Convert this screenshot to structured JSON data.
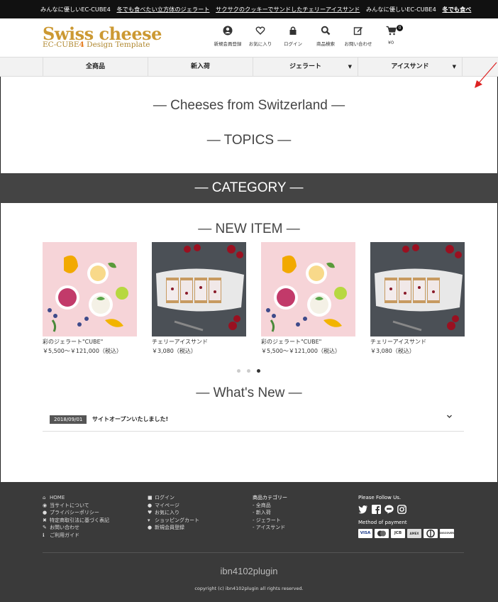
{
  "ticker": {
    "items": [
      {
        "text": "みんなに優しいEC-CUBE4",
        "style": "plain"
      },
      {
        "text": "冬でも食べたい立方体のジェラート",
        "style": "underline"
      },
      {
        "text": "サクサクのクッキーでサンドしたチェリーアイスサンド",
        "style": "underline"
      },
      {
        "text": "みんなに優しいEC-CUBE4",
        "style": "plain"
      },
      {
        "text": "冬でも食べ",
        "style": "bold-underline"
      }
    ]
  },
  "header": {
    "logo_title": "Swiss cheese",
    "logo_sub_prefix": "EC-CUBE",
    "logo_sub_num": "4",
    "logo_sub_suffix": " Design Template",
    "icons": [
      {
        "icon": "user-circle-icon",
        "label": "新規会員登録"
      },
      {
        "icon": "heart-icon",
        "label": "お気に入り"
      },
      {
        "icon": "lock-icon",
        "label": "ログイン"
      },
      {
        "icon": "search-icon",
        "label": "商品検索"
      },
      {
        "icon": "edit-icon",
        "label": "お問い合わせ"
      },
      {
        "icon": "cart-icon",
        "label": "¥0",
        "badge": "0"
      }
    ]
  },
  "nav": {
    "items": [
      {
        "label": "全商品",
        "dropdown": false
      },
      {
        "label": "新入荷",
        "dropdown": false
      },
      {
        "label": "ジェラート",
        "dropdown": true
      },
      {
        "label": "アイスサンド",
        "dropdown": true
      }
    ]
  },
  "sections": {
    "cheeses": "— Cheeses from Switzerland —",
    "topics": "— TOPICS —",
    "category": "— CATEGORY —",
    "new_item": "— NEW ITEM —",
    "whats_new": "— What's New —"
  },
  "products": [
    {
      "name": "彩のジェラート\"CUBE\"",
      "price": "￥5,500～￥121,000（税込）",
      "image": "gelato"
    },
    {
      "name": "チェリーアイスサンド",
      "price": "￥3,080（税込）",
      "image": "cherry"
    },
    {
      "name": "彩のジェラート\"CUBE\"",
      "price": "￥5,500～￥121,000（税込）",
      "image": "gelato"
    },
    {
      "name": "チェリーアイスサンド",
      "price": "￥3,080（税込）",
      "image": "cherry"
    }
  ],
  "carousel": {
    "count": 3,
    "active": 3
  },
  "news": [
    {
      "date": "2018/09/01",
      "title": "サイトオープンいたしました!"
    }
  ],
  "footer": {
    "col1": [
      {
        "icon": "home-icon",
        "label": "HOME"
      },
      {
        "icon": "info-icon",
        "label": "当サイトについて"
      },
      {
        "icon": "shield-icon",
        "label": "プライバシーポリシー"
      },
      {
        "icon": "tools-icon",
        "label": "特定商取引法に基づく表記"
      },
      {
        "icon": "mail-edit-icon",
        "label": "お問い合わせ"
      },
      {
        "icon": "info-i-icon",
        "label": "ご利用ガイド"
      }
    ],
    "col2": [
      {
        "icon": "lock-icon",
        "label": "ログイン"
      },
      {
        "icon": "user-cog-icon",
        "label": "マイページ"
      },
      {
        "icon": "heart-icon",
        "label": "お気に入り"
      },
      {
        "icon": "cart-icon",
        "label": "ショッピングカート"
      },
      {
        "icon": "user-icon",
        "label": "新規会員登録"
      }
    ],
    "col3_title": "商品カテゴリー",
    "col3": [
      "- 全商品",
      "- 新入荷",
      "- ジェラート",
      "- アイスサンド"
    ],
    "follow_title": "Please Follow Us.",
    "social": [
      "twitter-icon",
      "facebook-icon",
      "line-icon",
      "instagram-icon"
    ],
    "payment_title": "Method of payment",
    "payment": [
      "VISA",
      "MC",
      "JCB",
      "AMEX",
      "DINERS",
      "DISCOVER"
    ],
    "brand": "ibn4102plugin",
    "copyright": "copyright (c) ibn4102plugin all rights reserved."
  },
  "colors": {
    "logo": "#cc9933",
    "band": "#444444",
    "footer": "#3a3a3a",
    "arrow": "#dd2222"
  }
}
